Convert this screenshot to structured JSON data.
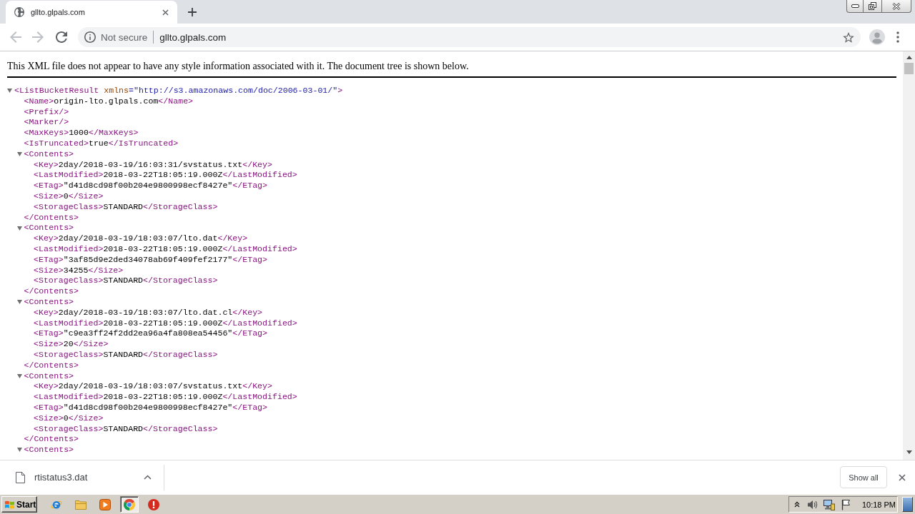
{
  "tabs": [
    {
      "title": "gllto.glpals.com",
      "selected": true
    }
  ],
  "navigation": [
    {
      "kind": "back",
      "disabled": true
    },
    {
      "kind": "forward",
      "disabled": true
    },
    {
      "kind": "reload",
      "disabled": false
    }
  ],
  "address_bar": {
    "security_label": "Not secure",
    "url": "gllto.glpals.com"
  },
  "page": {
    "notice": "This XML file does not appear to have any style information associated with it. The document tree is shown below.",
    "xml_tree": {
      "open": "<ListBucketResult",
      "attr_name": "xmlns",
      "attr_value": "=\"http://s3.amazonaws.com/doc/2006-03-01/\"",
      "open_end": ">",
      "expanded": true,
      "children": [
        {
          "open": "<Name>",
          "text": "origin-lto.glpals.com",
          "close": "</Name>"
        },
        {
          "open": "<Prefix/>"
        },
        {
          "open": "<Marker/>"
        },
        {
          "open": "<MaxKeys>",
          "text": "1000",
          "close": "</MaxKeys>"
        },
        {
          "open": "<IsTruncated>",
          "text": "true",
          "close": "</IsTruncated>"
        },
        {
          "open": "<Contents>",
          "expanded": true,
          "children": [
            {
              "open": "<Key>",
              "text": "2day/2018-03-19/16:03:31/svstatus.txt",
              "close": "</Key>"
            },
            {
              "open": "<LastModified>",
              "text": "2018-03-22T18:05:19.000Z",
              "close": "</LastModified>"
            },
            {
              "open": "<ETag>",
              "text": "\"d41d8cd98f00b204e9800998ecf8427e\"",
              "close": "</ETag>"
            },
            {
              "open": "<Size>",
              "text": "0",
              "close": "</Size>"
            },
            {
              "open": "<StorageClass>",
              "text": "STANDARD",
              "close": "</StorageClass>"
            }
          ],
          "closing_tag": "</Contents>"
        },
        {
          "open": "<Contents>",
          "expanded": true,
          "children": [
            {
              "open": "<Key>",
              "text": "2day/2018-03-19/18:03:07/lto.dat",
              "close": "</Key>"
            },
            {
              "open": "<LastModified>",
              "text": "2018-03-22T18:05:19.000Z",
              "close": "</LastModified>"
            },
            {
              "open": "<ETag>",
              "text": "\"3af85d9e2ded34078ab69f409fef2177\"",
              "close": "</ETag>"
            },
            {
              "open": "<Size>",
              "text": "34255",
              "close": "</Size>"
            },
            {
              "open": "<StorageClass>",
              "text": "STANDARD",
              "close": "</StorageClass>"
            }
          ],
          "closing_tag": "</Contents>"
        },
        {
          "open": "<Contents>",
          "expanded": true,
          "children": [
            {
              "open": "<Key>",
              "text": "2day/2018-03-19/18:03:07/lto.dat.cl",
              "close": "</Key>"
            },
            {
              "open": "<LastModified>",
              "text": "2018-03-22T18:05:19.000Z",
              "close": "</LastModified>"
            },
            {
              "open": "<ETag>",
              "text": "\"c9ea3ff24f2dd2ea96a4fa808ea54456\"",
              "close": "</ETag>"
            },
            {
              "open": "<Size>",
              "text": "20",
              "close": "</Size>"
            },
            {
              "open": "<StorageClass>",
              "text": "STANDARD",
              "close": "</StorageClass>"
            }
          ],
          "closing_tag": "</Contents>"
        },
        {
          "open": "<Contents>",
          "expanded": true,
          "children": [
            {
              "open": "<Key>",
              "text": "2day/2018-03-19/18:03:07/svstatus.txt",
              "close": "</Key>"
            },
            {
              "open": "<LastModified>",
              "text": "2018-03-22T18:05:19.000Z",
              "close": "</LastModified>"
            },
            {
              "open": "<ETag>",
              "text": "\"d41d8cd98f00b204e9800998ecf8427e\"",
              "close": "</ETag>"
            },
            {
              "open": "<Size>",
              "text": "0",
              "close": "</Size>"
            },
            {
              "open": "<StorageClass>",
              "text": "STANDARD",
              "close": "</StorageClass>"
            }
          ],
          "closing_tag": "</Contents>"
        },
        {
          "open": "<Contents>",
          "expanded": true
        }
      ]
    }
  },
  "downloads": {
    "items": [
      {
        "file_name": "rtistatus3.dat"
      }
    ],
    "show_all": "Show all"
  },
  "taskbar": {
    "start_label": "Start",
    "apps": [
      {
        "kind": "e_browser",
        "selected": false
      },
      {
        "kind": "folder",
        "selected": false
      },
      {
        "kind": "media_player",
        "selected": false
      },
      {
        "kind": "round_browser",
        "selected": true
      },
      {
        "kind": "alert",
        "selected": false
      }
    ],
    "clock": "10:18 PM"
  }
}
